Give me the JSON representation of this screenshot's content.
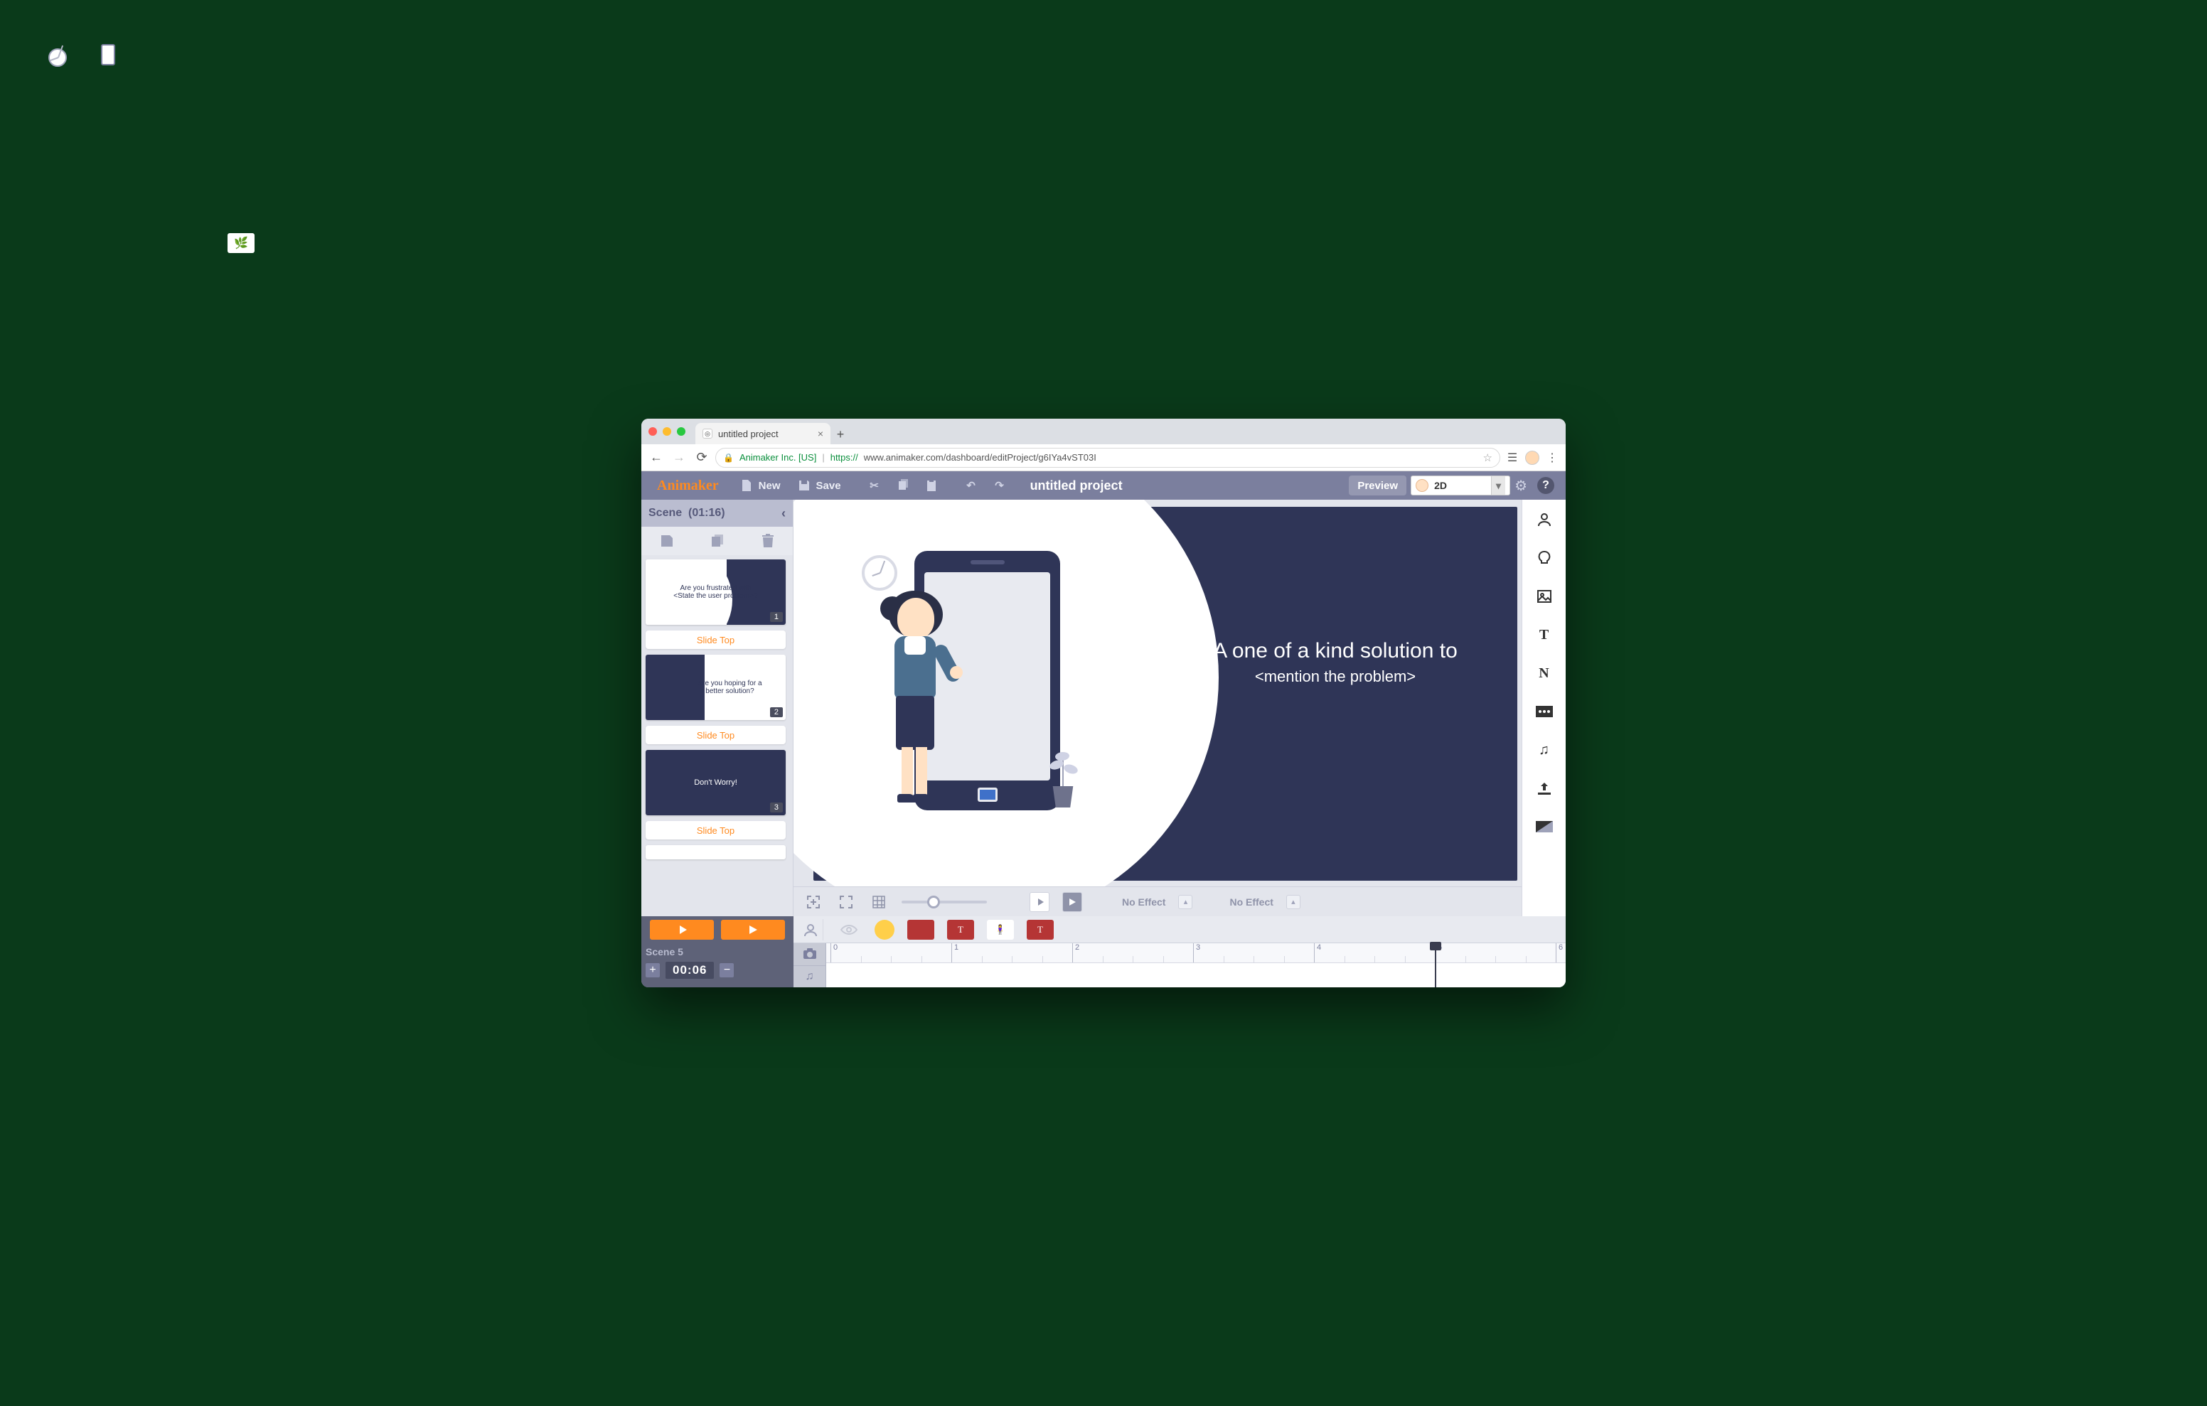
{
  "browser": {
    "tab_title": "untitled project",
    "org": "Animaker Inc. [US]",
    "url_protocol": "https://",
    "url_host": "www.animaker.com",
    "url_path": "/dashboard/editProject/g6IYa4vST03I"
  },
  "toolbar": {
    "logo": "Animaker",
    "new": "New",
    "save": "Save",
    "title": "untitled project",
    "preview": "Preview",
    "mode": "2D"
  },
  "scene_panel": {
    "title": "Scene",
    "duration": "(01:16)",
    "scenes": [
      {
        "num": "1",
        "text1": "Are you frustrated with",
        "text2": "<State the user problem>?",
        "type": "light"
      },
      {
        "num": "2",
        "text1": "Are you hoping for a",
        "text2": "better solution?",
        "type": "light"
      },
      {
        "num": "3",
        "text1": "Don't Worry!",
        "text2": "",
        "type": "dark"
      }
    ],
    "transitions": [
      "Slide Top",
      "Slide Top",
      "Slide Top"
    ]
  },
  "slide": {
    "line1": "A one of a kind solution to",
    "line2": "<mention the problem>"
  },
  "stage_bar": {
    "effect_in": "No Effect",
    "effect_out": "No Effect"
  },
  "timeline": {
    "scene_label": "Scene 5",
    "time": "00:06",
    "ruler_max": 6,
    "playhead_at": 5
  }
}
